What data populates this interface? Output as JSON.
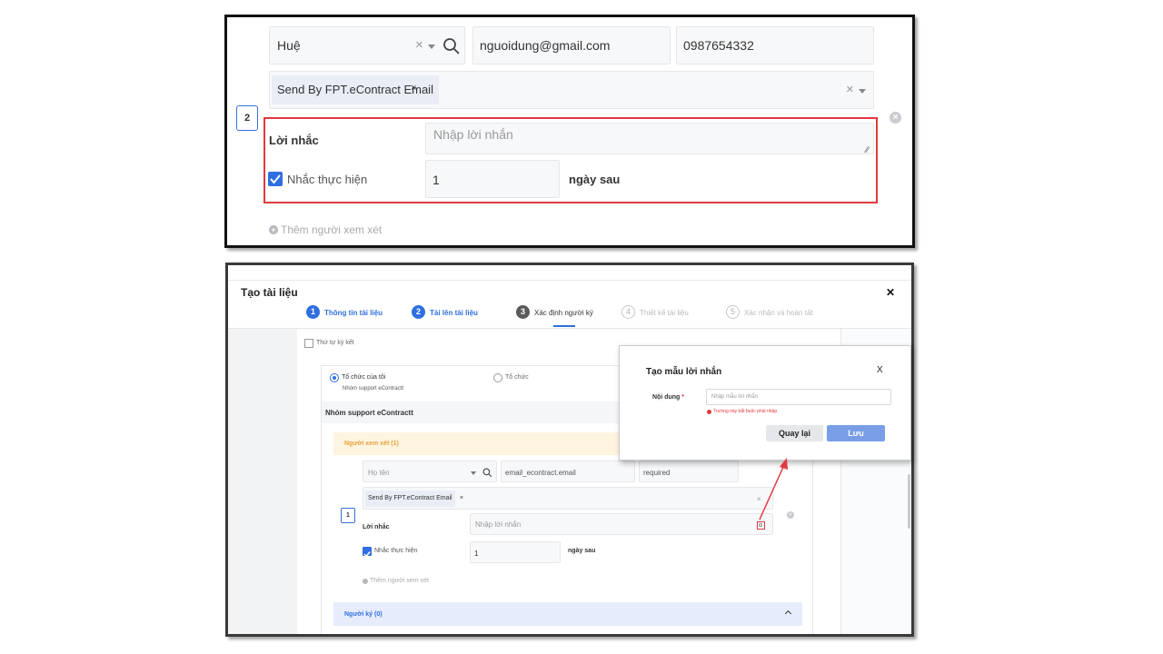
{
  "zoom": {
    "fullname_value": "Huệ",
    "email_value": "nguoidung@gmail.com",
    "phone_value": "0987654332",
    "send_method_tag": "Send By FPT.eContract Email",
    "tag_remove": "×",
    "clear_glyph": "×",
    "order_number": "2",
    "reminder_label": "Lời nhắc",
    "reminder_placeholder": "Nhập lời nhắn",
    "remind_checkbox_label": "Nhắc thực hiện",
    "remind_days_value": "1",
    "remind_days_suffix": "ngày sau",
    "add_reviewer": "Thêm người xem xét"
  },
  "dialog": {
    "title": "Tạo tài liệu",
    "close_glyph": "✕",
    "steps": [
      {
        "number": "1",
        "label": "Thông tin tài liệu",
        "state": "done"
      },
      {
        "number": "2",
        "label": "Tải lên tài liệu",
        "state": "done"
      },
      {
        "number": "3",
        "label": "Xác định người ký",
        "state": "current"
      },
      {
        "number": "4",
        "label": "Thiết kế tài liệu",
        "state": "todo"
      },
      {
        "number": "5",
        "label": "Xác nhận và hoàn tất",
        "state": "todo"
      }
    ],
    "signing_order_label": "Thứ tự ký kết",
    "org_option_mine": "Tổ chức của tôi",
    "org_option_mine_sub": "Nhóm support eContractt",
    "org_option_other": "Tổ chức",
    "group_title": "Nhóm support eContractt",
    "reviewer_section": "Người xem xét (1)",
    "fullname_placeholder": "Họ tên",
    "email_value": "email_econtract.email",
    "phone_value": "required",
    "send_method_tag": "Send By FPT.eContract Email",
    "tag_remove": "×",
    "clear_glyph": "×",
    "order_number": "1",
    "reminder_label": "Lời nhắc",
    "reminder_placeholder": "Nhập lời nhắn",
    "remind_checkbox_label": "Nhắc thực hiện",
    "remind_days_value": "1",
    "remind_days_suffix": "ngày sau",
    "add_reviewer": "Thêm người xem xét",
    "signer_section": "Người ký (0)"
  },
  "modal": {
    "title": "Tạo mẫu lời nhắn",
    "close_glyph": "X",
    "content_label": "Nội dung",
    "required_mark": "*",
    "content_placeholder": "Nhập mẫu lời nhắn",
    "error_text": "Trường này bắt buộc phải nhập.",
    "back_button": "Quay lại",
    "save_button": "Lưu"
  },
  "colors": {
    "primary": "#2f6fe0",
    "save_button": "#7a9ee6",
    "highlight_red": "#e0393e",
    "reviewer_header_bg": "#fff4e0",
    "reviewer_header_text": "#e6a23c",
    "signer_header_bg": "#e6ecfc"
  }
}
